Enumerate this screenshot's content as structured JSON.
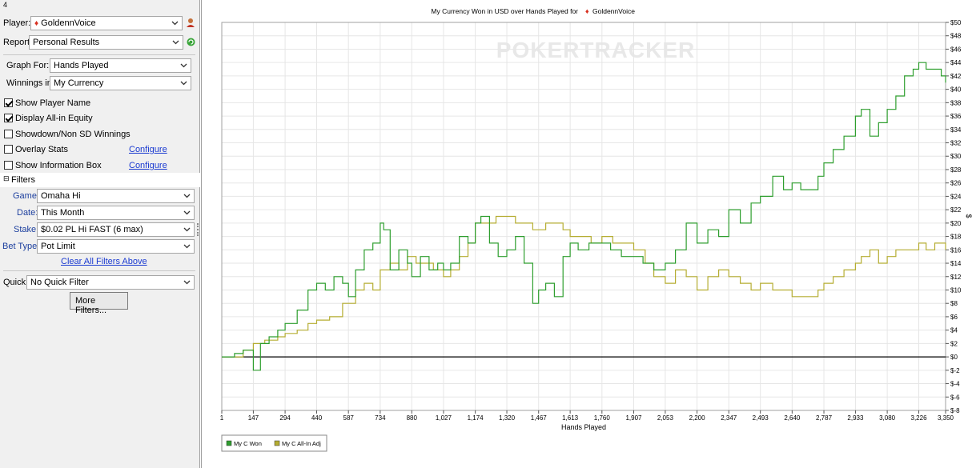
{
  "panel": {
    "top_marker": "4",
    "player_label": "Player:",
    "player_value": "GoldennVoice",
    "report_label": "Report:",
    "report_value": "Personal Results",
    "graph_for_label": "Graph For:",
    "graph_for_value": "Hands Played",
    "winnings_label": "Winnings in:",
    "winnings_value": "My Currency",
    "checkboxes": [
      {
        "label": "Show Player Name",
        "checked": true
      },
      {
        "label": "Display All-in Equity",
        "checked": true
      },
      {
        "label": "Showdown/Non SD Winnings",
        "checked": false
      },
      {
        "label": "Overlay Stats",
        "checked": false
      },
      {
        "label": "Show Information Box",
        "checked": false
      }
    ],
    "configure_1": "Configure",
    "configure_2": "Configure",
    "filters_header": "Filters",
    "game_label": "Game:",
    "game_value": "Omaha Hi",
    "date_label": "Date:",
    "date_value": "This Month",
    "stake_label": "Stake:",
    "stake_value": "$0.02 PL Hi FAST (6 max)",
    "bettype_label": "Bet Type:",
    "bettype_value": "Pot Limit",
    "clear_filters": "Clear All Filters Above",
    "quick_label": "Quick:",
    "quick_value": "No Quick Filter",
    "more_filters": "More Filters..."
  },
  "colors": {
    "won": "#2e9e2e",
    "allin": "#b5ad32",
    "accent_blue": "#1c3f9e"
  },
  "chart_data": {
    "type": "line",
    "title": "My Currency Won in USD over Hands Played for",
    "title_player": "GoldennVoice",
    "watermark": "POKERTRACKER",
    "xlabel": "Hands Played",
    "ylabel": "$",
    "xlim": [
      1,
      3350
    ],
    "ylim": [
      -8,
      50
    ],
    "x_ticks": [
      "1",
      "147",
      "294",
      "440",
      "587",
      "734",
      "880",
      "1,027",
      "1,174",
      "1,320",
      "1,467",
      "1,613",
      "1,760",
      "1,907",
      "2,053",
      "2,200",
      "2,347",
      "2,493",
      "2,640",
      "2,787",
      "2,933",
      "3,080",
      "3,226",
      "3,350"
    ],
    "x_tick_values": [
      1,
      147,
      294,
      440,
      587,
      734,
      880,
      1027,
      1174,
      1320,
      1467,
      1613,
      1760,
      1907,
      2053,
      2200,
      2347,
      2493,
      2640,
      2787,
      2933,
      3080,
      3226,
      3350
    ],
    "y_ticks": [
      "$50",
      "$48",
      "$46",
      "$44",
      "$42",
      "$40",
      "$38",
      "$36",
      "$34",
      "$32",
      "$30",
      "$28",
      "$26",
      "$24",
      "$22",
      "$20",
      "$18",
      "$16",
      "$14",
      "$12",
      "$10",
      "$8",
      "$6",
      "$4",
      "$2",
      "$0",
      "$-2",
      "$-4",
      "$-6",
      "$-8"
    ],
    "y_tick_values": [
      50,
      48,
      46,
      44,
      42,
      40,
      38,
      36,
      34,
      32,
      30,
      28,
      26,
      24,
      22,
      20,
      18,
      16,
      14,
      12,
      10,
      8,
      6,
      4,
      2,
      0,
      -2,
      -4,
      -6,
      -8
    ],
    "grid": true,
    "legend_position": "bottom-left",
    "series": [
      {
        "name": "My C Won",
        "x": [
          1,
          60,
          100,
          147,
          180,
          220,
          260,
          294,
          350,
          400,
          440,
          480,
          520,
          560,
          587,
          620,
          660,
          700,
          734,
          750,
          780,
          820,
          860,
          880,
          920,
          960,
          1000,
          1027,
          1060,
          1100,
          1140,
          1174,
          1200,
          1240,
          1280,
          1320,
          1360,
          1400,
          1440,
          1467,
          1500,
          1540,
          1580,
          1613,
          1650,
          1700,
          1760,
          1800,
          1850,
          1907,
          1950,
          2000,
          2053,
          2100,
          2150,
          2200,
          2250,
          2300,
          2347,
          2400,
          2450,
          2493,
          2550,
          2600,
          2640,
          2680,
          2720,
          2760,
          2787,
          2830,
          2880,
          2933,
          2960,
          3000,
          3040,
          3080,
          3120,
          3160,
          3200,
          3226,
          3260,
          3300,
          3330,
          3350
        ],
        "values": [
          0,
          0.5,
          1,
          -2,
          2,
          3,
          4,
          5,
          7,
          10,
          11,
          10,
          12,
          11,
          9,
          13,
          16,
          17,
          20,
          19,
          13,
          16,
          14,
          12,
          15,
          13,
          14,
          13,
          14,
          18,
          17,
          20,
          21,
          17,
          15,
          16,
          18,
          14,
          8,
          10,
          11,
          9,
          15,
          17,
          16,
          17,
          17,
          16,
          15,
          15,
          14,
          13,
          14,
          16,
          20,
          17,
          19,
          18,
          22,
          20,
          23,
          24,
          27,
          25,
          26,
          25,
          25,
          27,
          29,
          31,
          33,
          36,
          37,
          33,
          35,
          37,
          39,
          42,
          43,
          44,
          43,
          43,
          42,
          41
        ]
      },
      {
        "name": "My C All-In Adj",
        "x": [
          1,
          100,
          147,
          200,
          260,
          294,
          350,
          400,
          440,
          500,
          560,
          587,
          620,
          660,
          700,
          734,
          780,
          820,
          860,
          900,
          940,
          980,
          1027,
          1060,
          1100,
          1140,
          1174,
          1220,
          1270,
          1320,
          1360,
          1400,
          1440,
          1467,
          1500,
          1540,
          1580,
          1613,
          1660,
          1710,
          1760,
          1810,
          1860,
          1907,
          1960,
          2000,
          2053,
          2100,
          2150,
          2200,
          2250,
          2300,
          2347,
          2400,
          2450,
          2493,
          2550,
          2600,
          2640,
          2680,
          2720,
          2760,
          2787,
          2830,
          2880,
          2933,
          2960,
          3000,
          3040,
          3080,
          3120,
          3160,
          3200,
          3226,
          3260,
          3300,
          3330,
          3350
        ],
        "values": [
          0,
          1,
          2,
          2.5,
          3,
          3.5,
          4,
          5,
          5.5,
          6,
          8,
          8,
          10,
          11,
          10,
          13,
          14,
          13,
          15,
          14,
          14,
          13,
          12,
          13,
          15,
          17,
          20,
          20,
          21,
          21,
          20,
          20,
          19,
          19,
          20,
          20,
          19,
          18,
          18,
          17,
          18,
          17,
          17,
          16,
          14,
          12,
          11,
          13,
          12,
          10,
          12,
          13,
          12,
          11,
          10,
          11,
          10,
          10,
          9,
          9,
          9,
          10,
          11,
          12,
          13,
          14,
          15,
          16,
          14,
          15,
          16,
          16,
          16,
          17,
          16,
          17,
          17,
          16
        ]
      }
    ]
  }
}
